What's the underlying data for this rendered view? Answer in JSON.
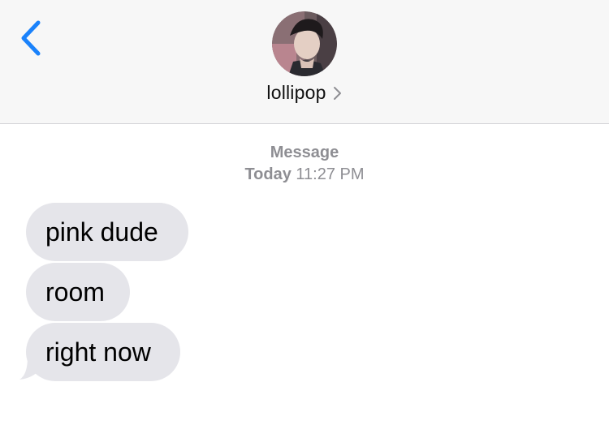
{
  "header": {
    "back_icon": "chevron-left-icon",
    "contact_name": "lollipop",
    "contact_chevron_icon": "chevron-right-icon",
    "accent_color": "#1a82fb"
  },
  "conversation": {
    "service_label": "Message",
    "timestamp_day": "Today",
    "timestamp_time": "11:27 PM",
    "messages": [
      {
        "text": "pink dude",
        "direction": "incoming"
      },
      {
        "text": "room",
        "direction": "incoming"
      },
      {
        "text": "right now",
        "direction": "incoming"
      }
    ],
    "incoming_bubble_color": "#e5e5ea"
  }
}
